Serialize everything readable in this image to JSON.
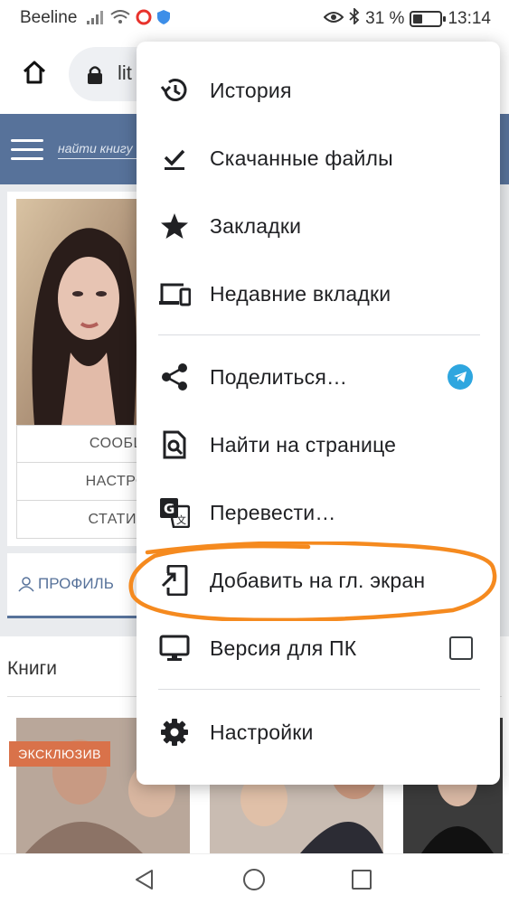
{
  "status_bar": {
    "carrier": "Beeline",
    "battery_text": "31 %",
    "battery_level": 0.31,
    "time": "13:14",
    "icons": [
      "signal-icon",
      "wifi-icon",
      "opera-icon",
      "shield-icon",
      "eye-icon",
      "bluetooth-icon",
      "battery-icon"
    ]
  },
  "browser": {
    "url_text": "lit",
    "home_icon": "home-icon",
    "lock_icon": "lock-icon"
  },
  "site": {
    "search_placeholder": "найти книгу",
    "profile_links": [
      "СООБЩ",
      "НАСТРО",
      "СТАТИС"
    ],
    "tab_profile": "ПРОФИЛЬ",
    "books_title": "Книги",
    "exclusive_badge": "ЭКСКЛЮЗИВ",
    "header_color": "#57729a"
  },
  "menu": {
    "items": [
      {
        "label": "История",
        "icon": "history-icon"
      },
      {
        "label": "Скачанные файлы",
        "icon": "downloads-icon"
      },
      {
        "label": "Закладки",
        "icon": "star-icon"
      },
      {
        "label": "Недавние вкладки",
        "icon": "devices-icon"
      },
      {
        "label": "Поделиться…",
        "icon": "share-icon",
        "extra_icon": "telegram-icon"
      },
      {
        "label": "Найти на странице",
        "icon": "find-in-page-icon"
      },
      {
        "label": "Перевести…",
        "icon": "translate-icon"
      },
      {
        "label": "Добавить на гл. экран",
        "icon": "add-to-home-icon",
        "highlighted": true
      },
      {
        "label": "Версия для ПК",
        "icon": "desktop-icon",
        "checkbox": false
      },
      {
        "label": "Настройки",
        "icon": "settings-icon"
      }
    ],
    "highlight_color": "#f58a1f"
  },
  "nav_bar": {
    "icons": [
      "back-icon",
      "home-circle-icon",
      "recents-icon"
    ]
  }
}
